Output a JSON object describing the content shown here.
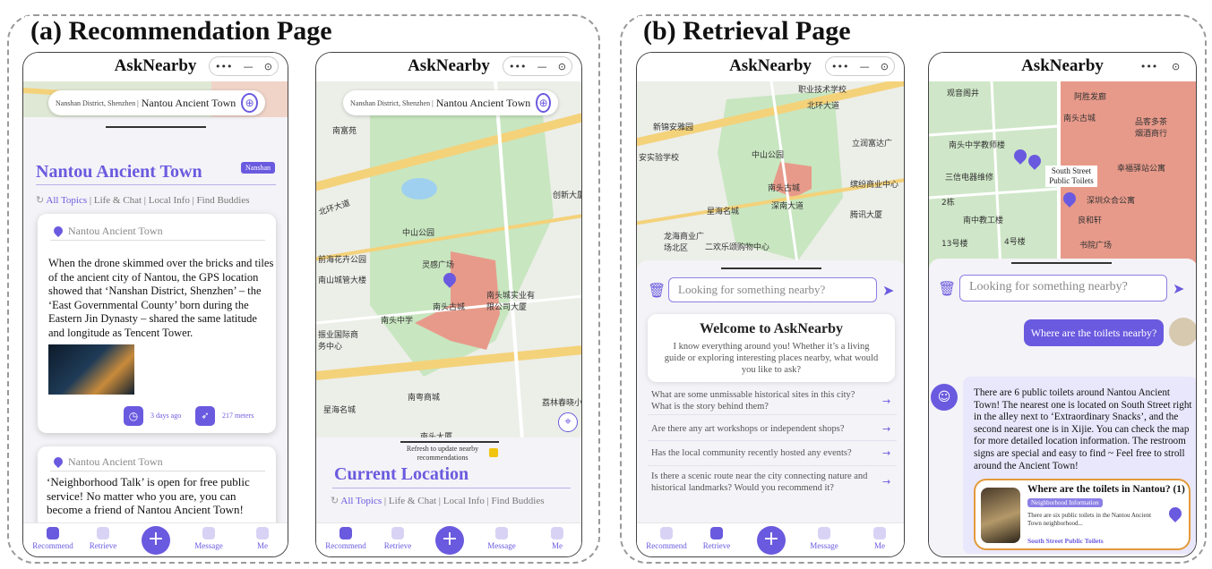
{
  "panels": {
    "left_title": "(a) Recommendation Page",
    "right_title": "(b) Retrieval Page"
  },
  "app": {
    "name": "AskNearby"
  },
  "capsule": {
    "dots": "•••",
    "minus": "—",
    "target": "⊙"
  },
  "location": {
    "district": "Nansshan District, Shenzhen",
    "district_text": "Nanshan District, Shenzhen |",
    "place": "Nantou Ancient Town"
  },
  "recommend": {
    "town_title": "Nantou Ancient Town",
    "tag": "Nanshan",
    "topics": [
      "All Topics",
      "Life & Chat",
      "Local Info",
      "Find Buddies"
    ],
    "cards": [
      {
        "location": "Nantou Ancient Town",
        "text": "When the drone skimmed over the bricks and tiles of the ancient city of Nantou, the GPS location showed that ‘Nanshan District, Shenzhen’ – the ‘East Governmental County’ born during the Eastern Jin Dynasty – shared the same latitude and longitude as Tencent Tower.",
        "time": "3 days ago",
        "distance": "217 meters"
      },
      {
        "location": "Nantou Ancient Town",
        "text": "‘Neighborhood Talk’ is open for free public service! No matter who you are, you can become a friend of Nantou Ancient Town!"
      }
    ],
    "refresh_text": "Refresh to update nearby recommendations",
    "current_location": "Current Location"
  },
  "nav": {
    "items": [
      "Recommend",
      "Retrieve",
      "Message",
      "Me"
    ],
    "plus": "+"
  },
  "map_labels": {
    "m1": [
      "南富苑",
      "北环大道",
      "中山公园",
      "灵感广场",
      "前海花卉公园",
      "南山城管大楼",
      "南头古城",
      "南头中学",
      "南头城实业有限公司大厦",
      "振业国际商务中心",
      "南粤商城",
      "星海名城",
      "荔林春晓小",
      "南头大厦",
      "创新大厦"
    ],
    "m2": [
      "职业技术学校",
      "北环大道",
      "新锦安雅园",
      "中山公园",
      "安实验学校",
      "立润富达广",
      "南头古城",
      "缤纷商业中心",
      "星海名城",
      "深南大道",
      "腾讯大厦",
      "龙海商业广场北区",
      "二欢乐颂购物中心"
    ],
    "m3": [
      "观音阁井",
      "阿胜发廊",
      "南头古城",
      "南头中学教师楼",
      "品客多茶烟酒商行",
      "三信电器维修",
      "幸福驿站公寓",
      "深圳众合公寓",
      "南中教工楼",
      "良和轩",
      "书院广场",
      "4号楼",
      "13号楼",
      "2栋"
    ]
  },
  "retrieve": {
    "search_placeholder": "Looking for something nearby?",
    "welcome_title": "Welcome to AskNearby",
    "welcome_text": "I know everything around you! Whether it’s a living guide or exploring interesting places nearby, what would you like to ask?",
    "questions": [
      "What are some unmissable historical sites in this city? What is the story behind them?",
      "Are there any art workshops or independent shops?",
      "Has the local community recently hosted any events?",
      "Is there a scenic route near the city connecting nature and historical landmarks? Would you recommend it?"
    ],
    "toilet_label": "South Street Public Toilets",
    "user_question": "Where are the toilets nearby?",
    "answer": "There are 6 public toilets around Nantou Ancient Town! The nearest one is located on South Street right in the alley next to ‘Extraordinary Snacks’, and the second nearest one is in Xijie. You can check the map for more detailed location information. The restroom signs are special and easy to find ~ Feel free to stroll around the Ancient Town!",
    "result_card": {
      "title": "Where are the toilets in Nantou? (1)",
      "badge": "Neighborhood Information",
      "text": "There are six public toilets in the Nantou Ancient Town neighborhood...",
      "link": "South Street Public Toilets"
    }
  },
  "colors": {
    "accent": "#6a5adf",
    "map_green": "#c8e6c0",
    "road_yellow": "#f4d27a",
    "highlight_red": "#e89a8a"
  }
}
